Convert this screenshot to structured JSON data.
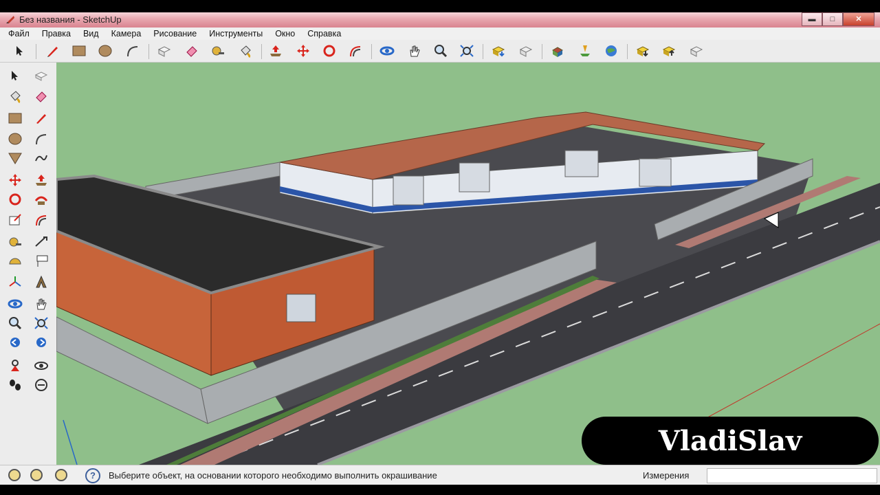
{
  "window": {
    "title": "Без названия - SketchUp",
    "buttons": {
      "minimize": "▬",
      "maximize": "□",
      "close": "✕"
    }
  },
  "menu": [
    "Файл",
    "Правка",
    "Вид",
    "Камера",
    "Рисование",
    "Инструменты",
    "Окно",
    "Справка"
  ],
  "toolbar_icons": [
    "select-icon",
    "pencil-icon",
    "rectangle-icon",
    "circle-icon",
    "arc-icon",
    "make-component-icon",
    "eraser-icon",
    "tape-measure-icon",
    "paint-bucket-icon",
    "push-pull-icon",
    "move-icon",
    "rotate-icon",
    "offset-icon",
    "orbit-icon",
    "pan-icon",
    "zoom-icon",
    "zoom-extents-icon",
    "get-models-icon",
    "share-model-icon",
    "components-icon",
    "add-location-icon",
    "google-earth-icon",
    "get-photo-texture-icon",
    "share-component-icon",
    "component-library-icon"
  ],
  "left_toolbar_icons": [
    "select-icon",
    "component-icon",
    "paint-bucket-icon",
    "eraser-icon",
    "rectangle-icon",
    "pencil-icon",
    "circle-icon",
    "arc-icon",
    "polygon-icon",
    "freehand-icon",
    "move-icon",
    "push-pull-icon",
    "rotate-icon",
    "follow-me-icon",
    "scale-icon",
    "offset-icon",
    "tape-measure-icon",
    "dimension-icon",
    "protractor-icon",
    "text-icon",
    "axes-icon",
    "3d-text-icon",
    "orbit-icon",
    "pan-icon",
    "zoom-icon",
    "zoom-window-icon",
    "previous-view-icon",
    "next-view-icon",
    "position-camera-icon",
    "look-around-icon",
    "walk-icon",
    "section-plane-icon"
  ],
  "viewport": {
    "colors": {
      "ground": "#8fbf8a",
      "asphalt": "#4a4a4f",
      "road": "#3d3d42",
      "brick": "#c7643a",
      "roof_dark": "#2b2b2b",
      "roof_rust": "#b5664a",
      "warehouse_wall": "#e7ebf1",
      "warehouse_stripe": "#2b55a8",
      "fence": "#a9adb0",
      "sidewalk": "#b07a73"
    }
  },
  "status": {
    "text": "Выберите объект, на основании которого необходимо выполнить окрашивание",
    "measurements_label": "Измерения",
    "measurements_value": ""
  },
  "watermark": {
    "text": "VladiSlav"
  }
}
